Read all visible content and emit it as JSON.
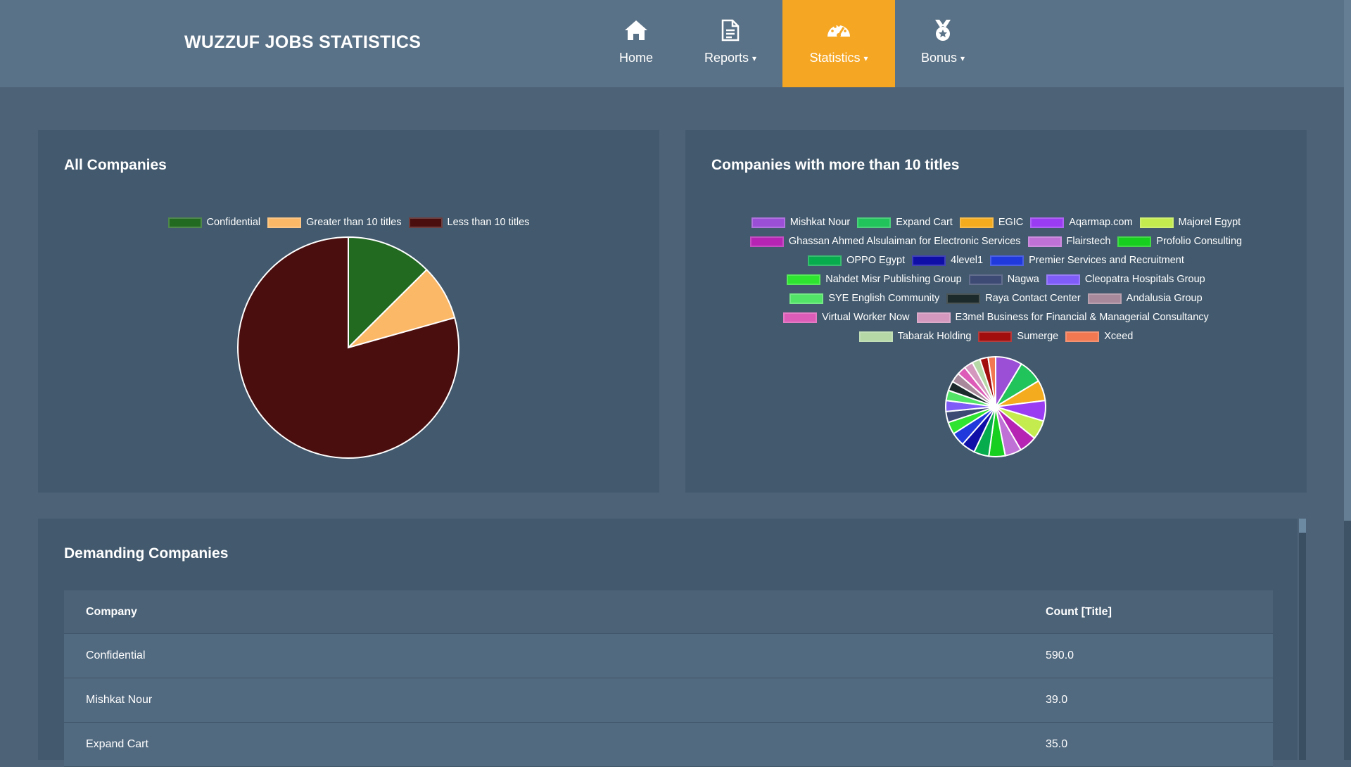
{
  "header": {
    "brand": "WUZZUF JOBS STATISTICS",
    "nav": [
      {
        "label": "Home",
        "icon": "home-icon",
        "has_dropdown": false,
        "active": false
      },
      {
        "label": "Reports",
        "icon": "document-icon",
        "has_dropdown": true,
        "active": false
      },
      {
        "label": "Statistics",
        "icon": "speedometer-icon",
        "has_dropdown": true,
        "active": true
      },
      {
        "label": "Bonus",
        "icon": "medal-icon",
        "has_dropdown": true,
        "active": false
      }
    ],
    "active_color": "#f5a623"
  },
  "cards": {
    "all_companies": {
      "title": "All Companies"
    },
    "more_than_10": {
      "title": "Companies with more than 10 titles"
    },
    "demanding": {
      "title": "Demanding Companies"
    }
  },
  "chart_data": [
    {
      "type": "pie",
      "title": "All Companies",
      "labels": [
        "Confidential",
        "Greater than 10 titles",
        "Less than 10 titles"
      ],
      "values": [
        590,
        380,
        3730
      ],
      "colors": [
        "#236a21",
        "#fbb867",
        "#4a0e0e"
      ]
    },
    {
      "type": "pie",
      "title": "Companies with more than 10 titles",
      "labels": [
        "Mishkat Nour",
        "Expand Cart",
        "EGIC",
        "Aqarmap.com",
        "Majorel Egypt",
        "Ghassan Ahmed Alsulaiman for Electronic Services",
        "Flairstech",
        "Profolio Consulting",
        "OPPO Egypt",
        "4level1",
        "Premier Services and Recruitment",
        "Nahdet Misr Publishing Group",
        "Nagwa",
        "Cleopatra Hospitals Group",
        "SYE English Community",
        "Raya Contact Center",
        "Andalusia Group",
        "Virtual Worker Now",
        "E3mel Business for Financial & Managerial Consultancy",
        "Tabarak Holding",
        "Sumerge",
        "Xceed"
      ],
      "values": [
        39,
        35,
        30,
        30,
        28,
        26,
        24,
        24,
        22,
        20,
        20,
        18,
        16,
        16,
        15,
        14,
        14,
        13,
        13,
        12,
        12,
        11
      ],
      "colors": [
        "#9b4fd6",
        "#21c45b",
        "#f4ab1e",
        "#9a3cf2",
        "#c4ec4f",
        "#b524b3",
        "#c071d6",
        "#17cf1f",
        "#07ad4d",
        "#0f0fa8",
        "#1f39dd",
        "#2ee430",
        "#3d4a73",
        "#7f5cf8",
        "#52e467",
        "#1d2a2b",
        "#a8899b",
        "#dd5cb7",
        "#d497bd",
        "#b5d8a6",
        "#a20d0d",
        "#f27852"
      ]
    }
  ],
  "table": {
    "headers": [
      "Company",
      "Count [Title]"
    ],
    "rows": [
      {
        "company": "Confidential",
        "count": "590.0"
      },
      {
        "company": "Mishkat Nour",
        "count": "39.0"
      },
      {
        "company": "Expand Cart",
        "count": "35.0"
      }
    ]
  }
}
